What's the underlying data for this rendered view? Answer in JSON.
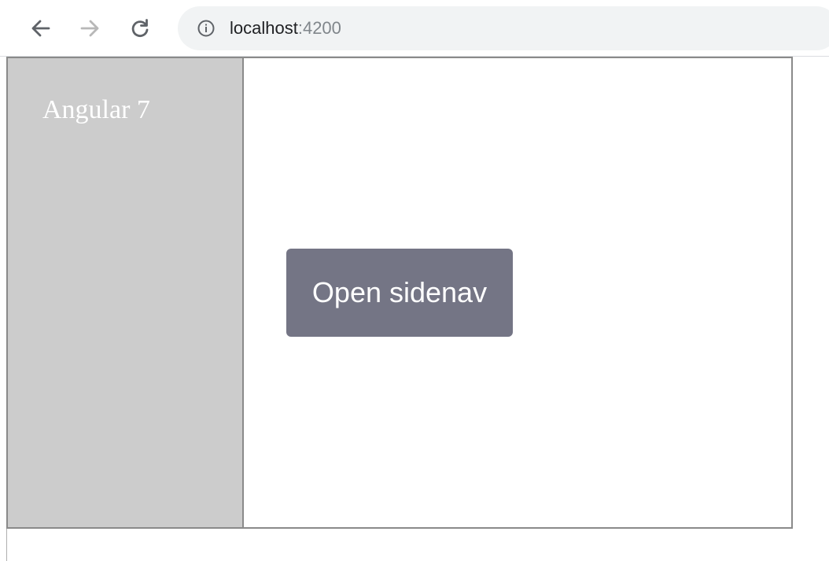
{
  "browser": {
    "url_host": "localhost",
    "url_port": ":4200",
    "icons": {
      "back": "arrow-left-icon",
      "forward": "arrow-right-icon",
      "reload": "reload-icon",
      "info": "info-icon"
    },
    "forward_enabled": false
  },
  "sidenav": {
    "title": "Angular 7",
    "background": "#cccccc"
  },
  "main": {
    "open_button_label": "Open sidenav",
    "button_color": "#747585"
  }
}
